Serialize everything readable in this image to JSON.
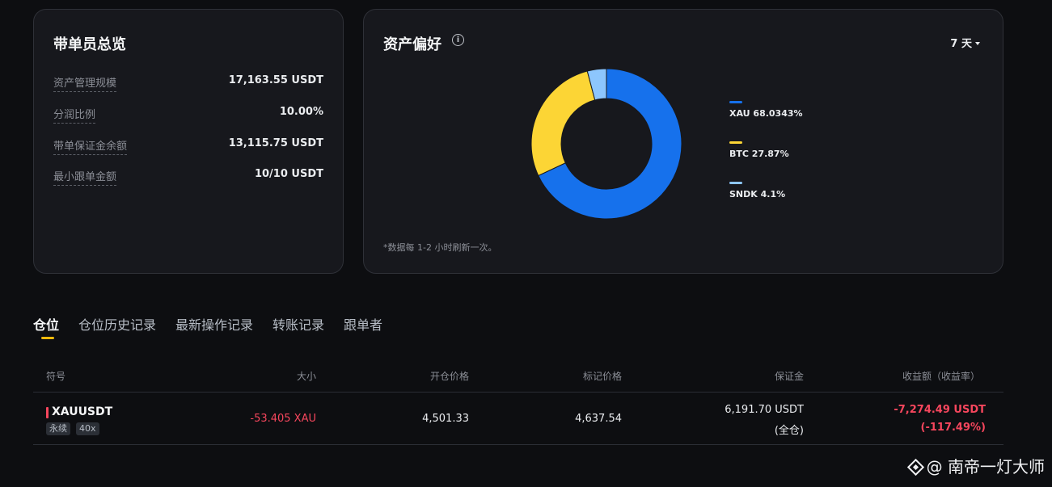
{
  "overview": {
    "title": "带单员总览",
    "stats": [
      {
        "label": "资产管理规模",
        "value": "17,163.55 USDT"
      },
      {
        "label": "分润比例",
        "value": "10.00%"
      },
      {
        "label": "带单保证金余额",
        "value": "13,115.75 USDT"
      },
      {
        "label": "最小跟单金额",
        "value": "10/10 USDT"
      }
    ]
  },
  "preference": {
    "title": "资产偏好",
    "info_icon": "i",
    "period": "7 天",
    "note": "*数据每 1-2 小时刷新一次。",
    "legend": [
      {
        "label": "XAU 68.0343%",
        "color": "#1671ec"
      },
      {
        "label": "BTC 27.87%",
        "color": "#fcd535"
      },
      {
        "label": "SNDK 4.1%",
        "color": "#8dc6fd"
      }
    ]
  },
  "chart_data": {
    "type": "pie",
    "donut": true,
    "categories": [
      "XAU",
      "BTC",
      "SNDK"
    ],
    "values": [
      68.0343,
      27.87,
      4.1
    ],
    "colors": [
      "#1671ec",
      "#fcd535",
      "#8dc6fd"
    ]
  },
  "tabs": [
    {
      "label": "仓位",
      "active": true
    },
    {
      "label": "仓位历史记录",
      "active": false
    },
    {
      "label": "最新操作记录",
      "active": false
    },
    {
      "label": "转账记录",
      "active": false
    },
    {
      "label": "跟单者",
      "active": false
    }
  ],
  "table": {
    "headers": [
      "符号",
      "大小",
      "开仓价格",
      "标记价格",
      "保证金",
      "收益额（收益率）"
    ],
    "rows": [
      {
        "symbol": "XAUUSDT",
        "badge_type": "永续",
        "badge_leverage": "40x",
        "size": "-53.405 XAU",
        "entry_price": "4,501.33",
        "mark_price": "4,637.54",
        "margin": "6,191.70 USDT",
        "margin_mode": "(全仓)",
        "pnl": "-7,274.49 USDT",
        "pnl_rate": "(-117.49%)"
      }
    ]
  },
  "watermark": {
    "text": "@ 南帝一灯大师"
  }
}
